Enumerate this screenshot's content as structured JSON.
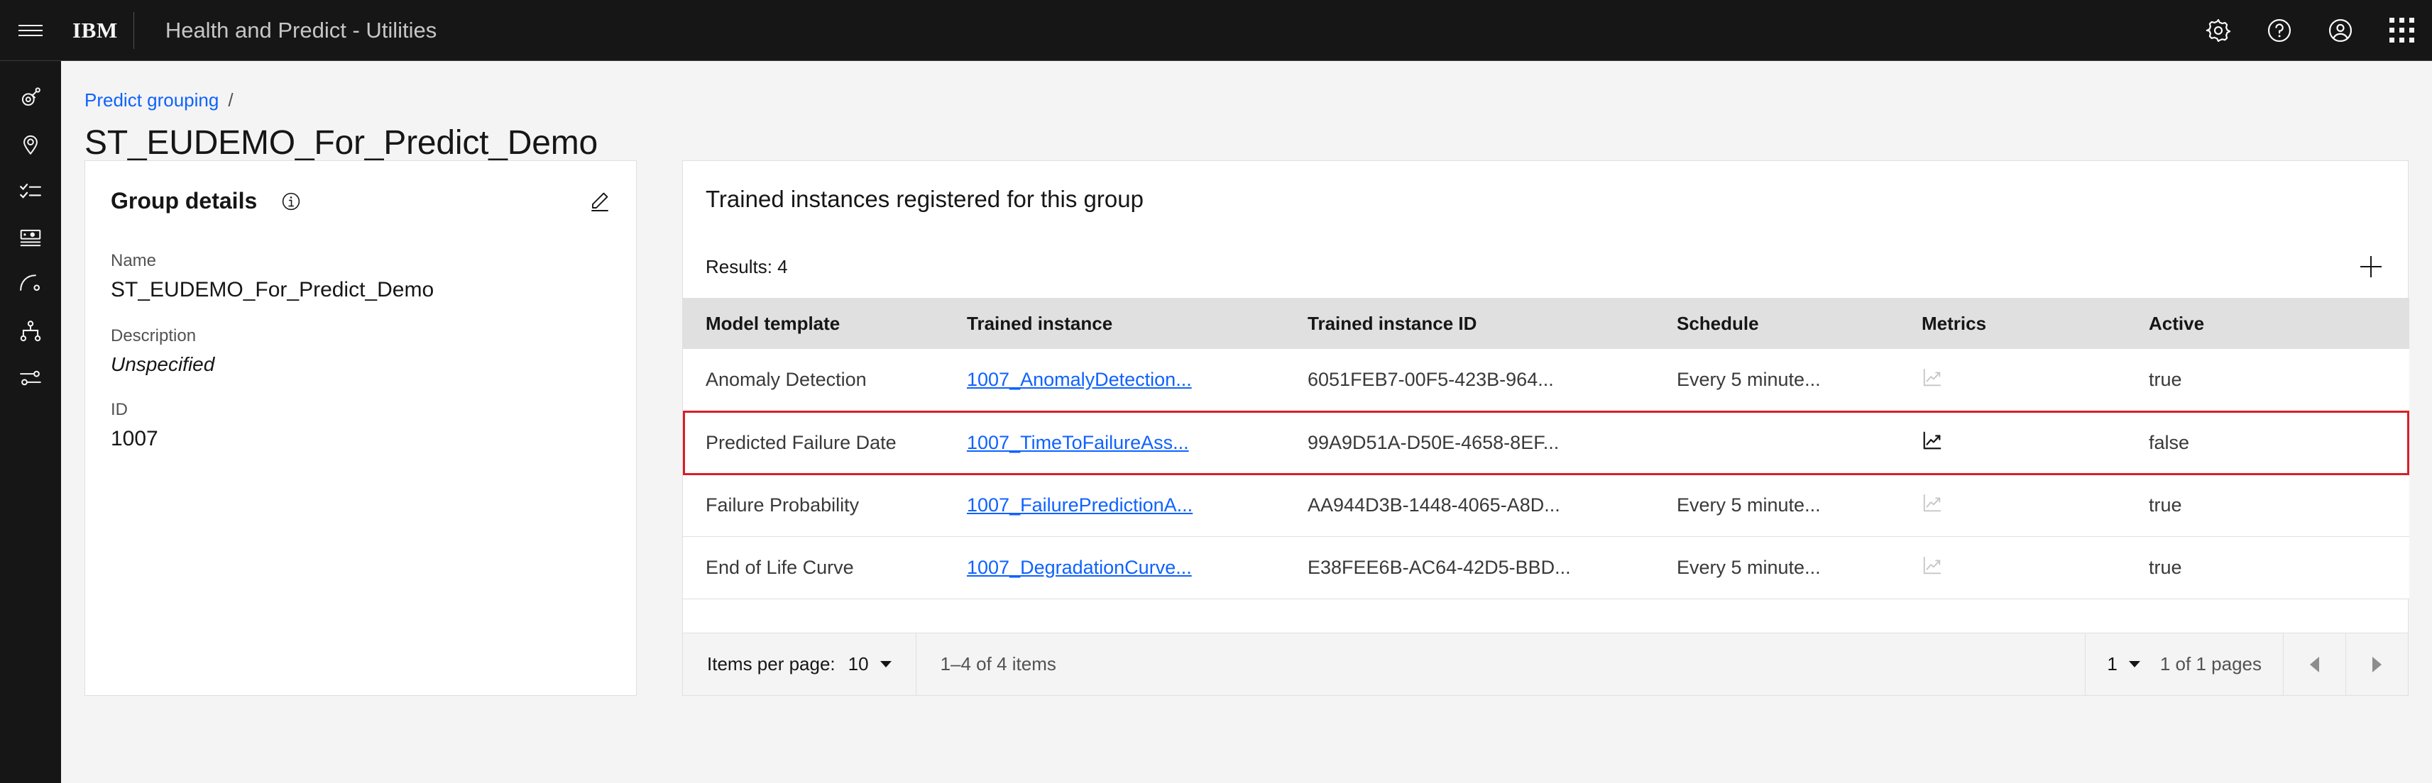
{
  "header": {
    "menu_icon": "hamburger-menu-icon",
    "brand": "IBM",
    "title": "Health and Predict - Utilities",
    "actions": [
      {
        "name": "settings",
        "icon": "gear-icon"
      },
      {
        "name": "help",
        "icon": "help-circle-icon"
      },
      {
        "name": "account",
        "icon": "user-avatar-icon"
      },
      {
        "name": "app-switcher",
        "icon": "grid-dots-icon"
      }
    ]
  },
  "rail": {
    "items": [
      {
        "name": "asset",
        "icon": "asset-tag-icon"
      },
      {
        "name": "location",
        "icon": "location-pin-icon"
      },
      {
        "name": "tasks",
        "icon": "checklist-icon"
      },
      {
        "name": "records",
        "icon": "id-card-icon"
      },
      {
        "name": "trend",
        "icon": "curve-point-icon"
      },
      {
        "name": "hierarchy",
        "icon": "hierarchy-tree-icon"
      },
      {
        "name": "settings-sliders",
        "icon": "sliders-icon"
      }
    ]
  },
  "breadcrumb": {
    "link": "Predict grouping",
    "separator": "/"
  },
  "page": {
    "title": "ST_EUDEMO_For_Predict_Demo"
  },
  "details_card": {
    "title": "Group details",
    "info_icon": "information-circle-icon",
    "edit_icon": "edit-pencil-icon",
    "fields": [
      {
        "label": "Name",
        "value": "ST_EUDEMO_For_Predict_Demo",
        "italic": false
      },
      {
        "label": "Description",
        "value": "Unspecified",
        "italic": true
      },
      {
        "label": "ID",
        "value": "1007",
        "italic": false
      }
    ]
  },
  "table_panel": {
    "title": "Trained instances registered for this group",
    "results_label": "Results: 4",
    "add_icon": "plus-icon",
    "columns": [
      "Model template",
      "Trained instance",
      "Trained instance ID",
      "Schedule",
      "Metrics",
      "Active"
    ],
    "rows": [
      {
        "model_template": "Anomaly Detection",
        "trained_instance": "1007_AnomalyDetection...",
        "trained_instance_id": "6051FEB7-00F5-423B-964...",
        "schedule": "Every 5 minute...",
        "metrics_icon": "chart-line-icon",
        "metrics_enabled": false,
        "active": "true",
        "highlighted": false
      },
      {
        "model_template": "Predicted Failure Date",
        "trained_instance": "1007_TimeToFailureAss...",
        "trained_instance_id": "99A9D51A-D50E-4658-8EF...",
        "schedule": "",
        "metrics_icon": "chart-line-icon",
        "metrics_enabled": true,
        "active": "false",
        "highlighted": true
      },
      {
        "model_template": "Failure Probability",
        "trained_instance": "1007_FailurePredictionA...",
        "trained_instance_id": "AA944D3B-1448-4065-A8D...",
        "schedule": "Every 5 minute...",
        "metrics_icon": "chart-line-icon",
        "metrics_enabled": false,
        "active": "true",
        "highlighted": false
      },
      {
        "model_template": "End of Life Curve",
        "trained_instance": "1007_DegradationCurve...",
        "trained_instance_id": "E38FEE6B-AC64-42D5-BBD...",
        "schedule": "Every 5 minute...",
        "metrics_icon": "chart-line-icon",
        "metrics_enabled": false,
        "active": "true",
        "highlighted": false
      }
    ]
  },
  "pagination": {
    "items_per_page_label": "Items per page:",
    "items_per_page_value": "10",
    "range_label": "1–4 of 4 items",
    "page_value": "1",
    "pages_label": "1 of 1 pages",
    "prev_icon": "caret-left-icon",
    "next_icon": "caret-right-icon"
  },
  "colors": {
    "header_bg": "#161616",
    "accent_link": "#0f62fe",
    "highlight_border": "#da1e28",
    "page_bg": "#f4f4f4"
  }
}
